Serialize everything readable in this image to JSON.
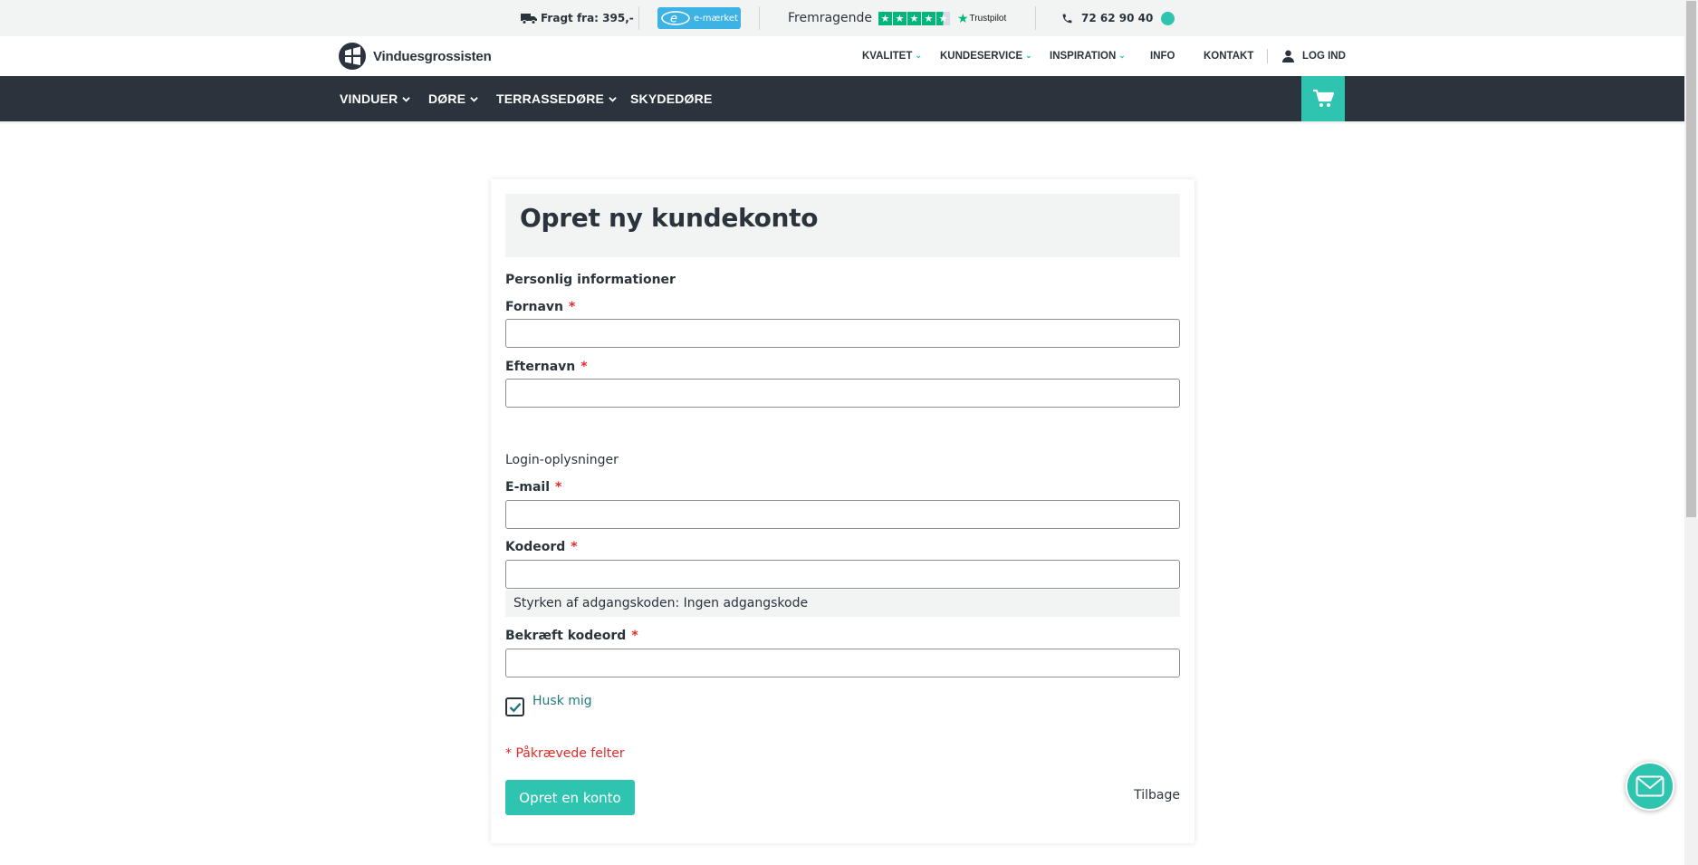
{
  "topbar": {
    "shipping": "Fragt fra: 395,-",
    "emaerket": "e-mærket",
    "trustpilot_rating": "Fremragende",
    "trustpilot_brand": "Trustpilot",
    "phone": "72 62 90 40"
  },
  "header": {
    "logo_text": "Vinduesgrossisten",
    "nav": {
      "kvalitet": "KVALITET",
      "kundeservice": "KUNDESERVICE",
      "inspiration": "INSPIRATION",
      "info": "INFO",
      "kontakt": "KONTAKT",
      "login": "LOG IND"
    }
  },
  "mainnav": {
    "vinduer": "VINDUER",
    "doere": "DØRE",
    "terrassedoere": "TERRASSEDØRE",
    "skydedoere": "SKYDEDØRE"
  },
  "form": {
    "title": "Opret ny kundekonto",
    "personal_heading": "Personlig informationer",
    "firstname_label": "Fornavn",
    "lastname_label": "Efternavn",
    "login_heading": "Login-oplysninger",
    "email_label": "E-mail",
    "password_label": "Kodeord",
    "password_strength": "Styrken af adgangskoden: Ingen adgangskode",
    "confirm_label": "Bekræft kodeord",
    "required_marker": "*",
    "remember_label": "Husk mig",
    "remember_checked": true,
    "required_note": "* Påkrævede felter",
    "submit_label": "Opret en konto",
    "back_label": "Tilbage",
    "firstname_value": "",
    "lastname_value": "",
    "email_value": "",
    "password_value": "",
    "confirm_value": ""
  },
  "colors": {
    "accent": "#2ec4b0",
    "dark": "#2b343d",
    "required": "#e02b27",
    "emaerket": "#3db2e4",
    "trustpilot": "#00b67a"
  }
}
